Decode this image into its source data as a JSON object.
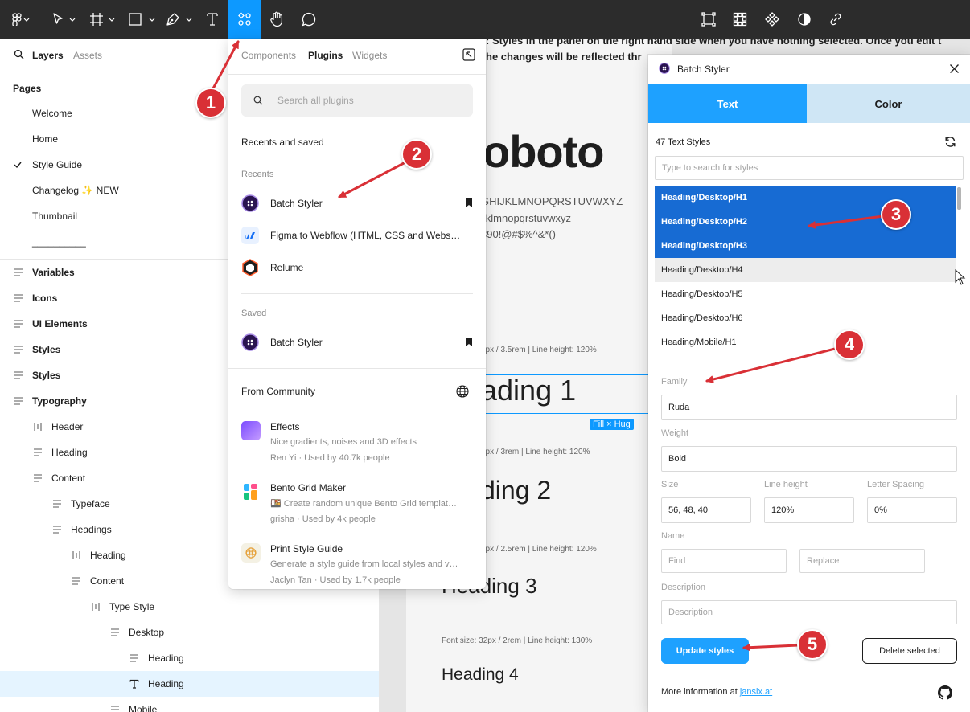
{
  "toolbar": {
    "tools": [
      {
        "name": "main-menu-icon"
      },
      {
        "name": "move-tool-icon"
      },
      {
        "name": "frame-tool-icon"
      },
      {
        "name": "shape-tool-icon"
      },
      {
        "name": "pen-tool-icon"
      },
      {
        "name": "text-tool-icon"
      },
      {
        "name": "resources-tool-icon",
        "active": true
      },
      {
        "name": "hand-tool-icon"
      },
      {
        "name": "comment-tool-icon"
      }
    ],
    "right_tools": [
      "frame-selection-icon",
      "grid-icon",
      "component-icon",
      "contrast-icon",
      "link-icon"
    ]
  },
  "left_panel": {
    "tabs": {
      "layers": "Layers",
      "assets": "Assets"
    },
    "pages_title": "Pages",
    "pages": [
      {
        "label": "Welcome",
        "current": false
      },
      {
        "label": "Home",
        "current": false
      },
      {
        "label": "Style Guide",
        "current": true
      },
      {
        "label": "Changelog ✨ NEW",
        "current": false
      },
      {
        "label": "Thumbnail",
        "current": false
      },
      {
        "label": "__________",
        "current": false
      }
    ],
    "layers": [
      {
        "label": "Variables",
        "icon": "section",
        "indent": 0,
        "bold": true
      },
      {
        "label": "Icons",
        "icon": "section",
        "indent": 0,
        "bold": true
      },
      {
        "label": "UI Elements",
        "icon": "section",
        "indent": 0,
        "bold": true
      },
      {
        "label": "Styles",
        "icon": "section",
        "indent": 0,
        "bold": true
      },
      {
        "label": "Styles",
        "icon": "section",
        "indent": 0,
        "bold": true
      },
      {
        "label": "Typography",
        "icon": "section",
        "indent": 0,
        "bold": true
      },
      {
        "label": "Header",
        "icon": "autolayout-h",
        "indent": 1,
        "bold": false
      },
      {
        "label": "Heading",
        "icon": "section",
        "indent": 1,
        "bold": false
      },
      {
        "label": "Content",
        "icon": "section",
        "indent": 1,
        "bold": false
      },
      {
        "label": "Typeface",
        "icon": "section",
        "indent": 2,
        "bold": false
      },
      {
        "label": "Headings",
        "icon": "section",
        "indent": 2,
        "bold": false
      },
      {
        "label": "Heading",
        "icon": "autolayout-h",
        "indent": 3,
        "bold": false
      },
      {
        "label": "Content",
        "icon": "section",
        "indent": 3,
        "bold": false
      },
      {
        "label": "Type Style",
        "icon": "autolayout-h",
        "indent": 4,
        "bold": false
      },
      {
        "label": "Desktop",
        "icon": "section",
        "indent": 5,
        "bold": false
      },
      {
        "label": "Heading",
        "icon": "section",
        "indent": 6,
        "bold": false
      },
      {
        "label": "Heading",
        "icon": "text",
        "indent": 6,
        "bold": false,
        "selected": true
      },
      {
        "label": "Mobile",
        "icon": "section",
        "indent": 5,
        "bold": false
      }
    ]
  },
  "canvas": {
    "top_text_1": ": Styles in the panel on the right hand side when you have nothing selected. Once you edit t",
    "top_text_2": "he changes will be reflected thr",
    "font_name": "oboto",
    "alphabet_upper": "GHIJKLMNOPQRSTUVWXYZ",
    "alphabet_lower": "ijklmnopqrstuvwxyz",
    "symbols": "890!@#$%^&*()",
    "paren": ")",
    "spec_h1": "6px / 3.5rem | Line height: 120%",
    "heading_1": "ading 1",
    "fill_hug": "Fill × Hug",
    "spec_h2": "8px / 3rem | Line height: 120%",
    "heading_2": "ding 2",
    "spec_h3": "0px / 2.5rem | Line height: 120%",
    "heading_3": "Heading 3",
    "spec_h4": "Font size: 32px / 2rem | Line height: 130%",
    "heading_4": "Heading 4"
  },
  "plugins": {
    "tabs": {
      "components": "Components",
      "plugins": "Plugins",
      "widgets": "Widgets"
    },
    "search_placeholder": "Search all plugins",
    "recents_and_saved": "Recents and saved",
    "recents_label": "Recents",
    "recents": [
      {
        "name": "Batch Styler",
        "bookmarked": true,
        "icon": "batch-styler"
      },
      {
        "name": "Figma to Webflow (HTML, CSS and Webs…",
        "bookmarked": false,
        "icon": "webflow"
      },
      {
        "name": "Relume",
        "bookmarked": false,
        "icon": "relume"
      }
    ],
    "saved_label": "Saved",
    "saved": [
      {
        "name": "Batch Styler",
        "bookmarked": true,
        "icon": "batch-styler"
      }
    ],
    "community_label": "From Community",
    "community": [
      {
        "name": "Effects",
        "desc": "Nice gradients, noises and 3D effects",
        "meta": "Ren Yi · Used by 40.7k people",
        "color": "#9b6cf0"
      },
      {
        "name": "Bento Grid Maker",
        "desc": "🍱 Create random unique Bento Grid templat…",
        "meta": "grisha · Used by 4k people",
        "color": "#ffffff"
      },
      {
        "name": "Print Style Guide",
        "desc": "Generate a style guide from local styles and v…",
        "meta": "Jaclyn Tan · Used by 1.7k people",
        "color": "#f4f1e4"
      }
    ]
  },
  "batch_styler": {
    "title": "Batch Styler",
    "tab_text": "Text",
    "tab_color": "Color",
    "count": "47 Text Styles",
    "search_placeholder": "Type to search for styles",
    "styles": [
      {
        "label": "Heading/Desktop/H1",
        "state": "selected"
      },
      {
        "label": "Heading/Desktop/H2",
        "state": "selected"
      },
      {
        "label": "Heading/Desktop/H3",
        "state": "selected"
      },
      {
        "label": "Heading/Desktop/H4",
        "state": "hover"
      },
      {
        "label": "Heading/Desktop/H5",
        "state": "normal"
      },
      {
        "label": "Heading/Desktop/H6",
        "state": "normal"
      },
      {
        "label": "Heading/Mobile/H1",
        "state": "normal"
      }
    ],
    "family_label": "Family",
    "family_value": "Ruda",
    "weight_label": "Weight",
    "weight_value": "Bold",
    "size_label": "Size",
    "size_value": "56, 48, 40",
    "line_height_label": "Line height",
    "line_height_value": "120%",
    "letter_spacing_label": "Letter Spacing",
    "letter_spacing_value": "0%",
    "name_label": "Name",
    "find_placeholder": "Find",
    "replace_placeholder": "Replace",
    "description_label": "Description",
    "description_placeholder": "Description",
    "update_button": "Update styles",
    "delete_button": "Delete selected",
    "more_info": "More information at ",
    "more_info_link": "jansix.at",
    "accent": "#1ea1ff",
    "selected_row_color": "#176bd3"
  },
  "annotations": {
    "color": "#d93036",
    "badges": [
      "1",
      "2",
      "3",
      "4",
      "5"
    ]
  }
}
